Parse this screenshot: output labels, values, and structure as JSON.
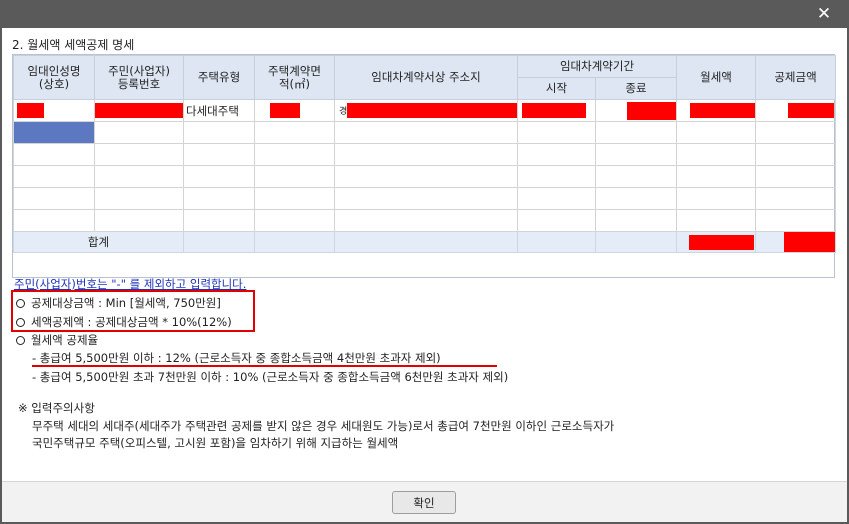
{
  "window": {
    "close_label": "✕"
  },
  "section_title": "2. 월세액 세액공제 명세",
  "table": {
    "headers": {
      "landlord_name": "임대인성명\n(상호)",
      "resident_id": "주민(사업자)\n등록번호",
      "house_type": "주택유형",
      "area": "주택계약면\n적(㎡)",
      "address": "임대차계약서상 주소지",
      "period": "임대차계약기간",
      "start": "시작",
      "end": "종료",
      "monthly_rent": "월세액",
      "deduction": "공제금액"
    },
    "row1": {
      "house_type": "다세대주택",
      "addr_prefix": "경"
    },
    "total_label": "합계"
  },
  "hint_text": "주민(사업자)번호는 \"-\" 를 제외하고 입력합니다.",
  "notes": {
    "deductible_amount": "공제대상금액   : Min [월세액, 750만원]",
    "tax_credit": "세액공제액 : 공제대상금액 * 10%(12%)",
    "rate_title": "월세액 공제율",
    "rate_line1": "- 총급여 5,500만원 이하 : 12% (근로소득자 중 종합소득금액 4천만원 초과자 제외)",
    "rate_line2": "- 총급여 5,500만원 초과 7천만원 이하 : 10% (근로소득자 중 종합소득금액 6천만원 초과자 제외)",
    "caution_title": "※ 입력주의사항",
    "caution_line1": "무주택 세대의 세대주(세대주가 주택관련 공제를 받지 않은 경우 세대원도 가능)로서 총급여 7천만원 이하인 근로소득자가",
    "caution_line2": "국민주택규모 주택(오피스텔, 고시원 포함)을 임차하기 위해 지급하는 월세액"
  },
  "confirm_label": "확인",
  "colors": {
    "redaction": "#ff0000",
    "highlight": "#e00000",
    "header_bg": "#dde6f2",
    "selection": "#5c78c0",
    "link": "#1e33b8"
  }
}
